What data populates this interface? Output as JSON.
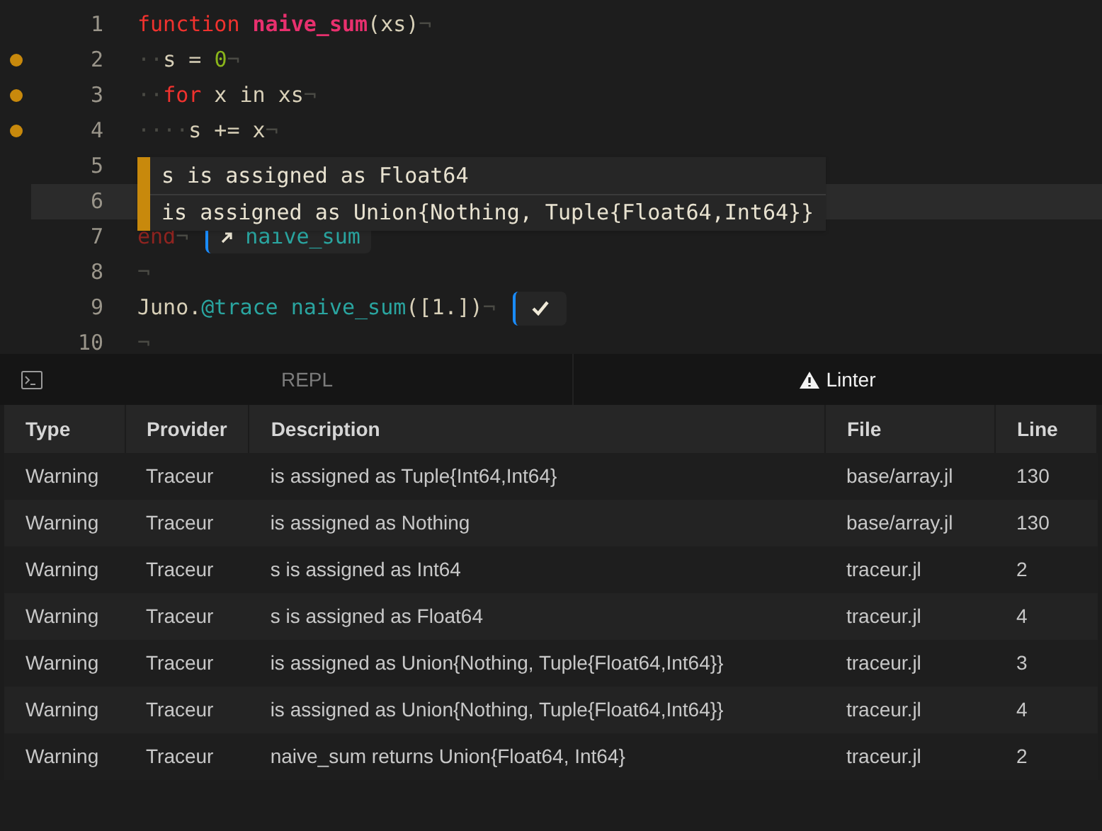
{
  "editor": {
    "lines": [
      {
        "number": "1",
        "marker": false,
        "current": false,
        "tokens": [
          {
            "kind": "keyword",
            "text": "function"
          },
          {
            "kind": "function",
            "text": "naive_sum",
            "gap": true
          },
          {
            "kind": "plain",
            "text": "(xs)"
          }
        ],
        "eol": "¬"
      },
      {
        "number": "2",
        "marker": true,
        "current": false,
        "tokens": [
          {
            "kind": "ws",
            "text": "··"
          },
          {
            "kind": "plain",
            "text": "s = "
          },
          {
            "kind": "number",
            "text": "0"
          }
        ],
        "eol": "¬"
      },
      {
        "number": "3",
        "marker": true,
        "current": false,
        "tokens": [
          {
            "kind": "ws",
            "text": "··"
          },
          {
            "kind": "keyword",
            "text": "for"
          },
          {
            "kind": "plain",
            "text": "x in xs",
            "gap": true
          }
        ],
        "eol": "¬"
      },
      {
        "number": "4",
        "marker": true,
        "current": false,
        "tokens": [
          {
            "kind": "ws",
            "text": "····"
          },
          {
            "kind": "plain",
            "text": "s += x"
          }
        ],
        "eol": "¬"
      },
      {
        "number": "5",
        "marker": false,
        "current": false
      },
      {
        "number": "6",
        "marker": false,
        "current": true
      },
      {
        "number": "7",
        "marker": false,
        "current": false,
        "tokens": [
          {
            "kind": "endkw",
            "text": "end"
          }
        ],
        "eol": "¬",
        "result": {
          "kind": "value",
          "text": "naive_sum"
        }
      },
      {
        "number": "8",
        "marker": false,
        "current": false,
        "eol": "¬"
      },
      {
        "number": "9",
        "marker": false,
        "current": false,
        "tokens": [
          {
            "kind": "plain",
            "text": "Juno."
          },
          {
            "kind": "macro",
            "text": "@trace"
          },
          {
            "kind": "call",
            "text": "naive_sum",
            "gap": true
          },
          {
            "kind": "plain",
            "text": "([1.])"
          }
        ],
        "eol": "¬",
        "result": {
          "kind": "done"
        }
      },
      {
        "number": "10",
        "marker": false,
        "current": false,
        "eol": "¬"
      }
    ],
    "tooltip": [
      "s is assigned as Float64",
      "is assigned as Union{Nothing, Tuple{Float64,Int64}}"
    ]
  },
  "tabs": [
    {
      "label": "REPL",
      "kind": "repl",
      "selected": false
    },
    {
      "label": "Linter",
      "kind": "linter",
      "selected": true
    }
  ],
  "table": {
    "columns": [
      "Type",
      "Provider",
      "Description",
      "File",
      "Line"
    ],
    "rows": [
      [
        "Warning",
        "Traceur",
        "is assigned as Tuple{Int64,Int64}",
        "base/array.jl",
        "130"
      ],
      [
        "Warning",
        "Traceur",
        "is assigned as Nothing",
        "base/array.jl",
        "130"
      ],
      [
        "Warning",
        "Traceur",
        "s is assigned as Int64",
        "traceur.jl",
        "2"
      ],
      [
        "Warning",
        "Traceur",
        "s is assigned as Float64",
        "traceur.jl",
        "4"
      ],
      [
        "Warning",
        "Traceur",
        "is assigned as Union{Nothing, Tuple{Float64,Int64}}",
        "traceur.jl",
        "3"
      ],
      [
        "Warning",
        "Traceur",
        "is assigned as Union{Nothing, Tuple{Float64,Int64}}",
        "traceur.jl",
        "4"
      ],
      [
        "Warning",
        "Traceur",
        "naive_sum returns Union{Float64, Int64}",
        "traceur.jl",
        "2"
      ]
    ]
  }
}
